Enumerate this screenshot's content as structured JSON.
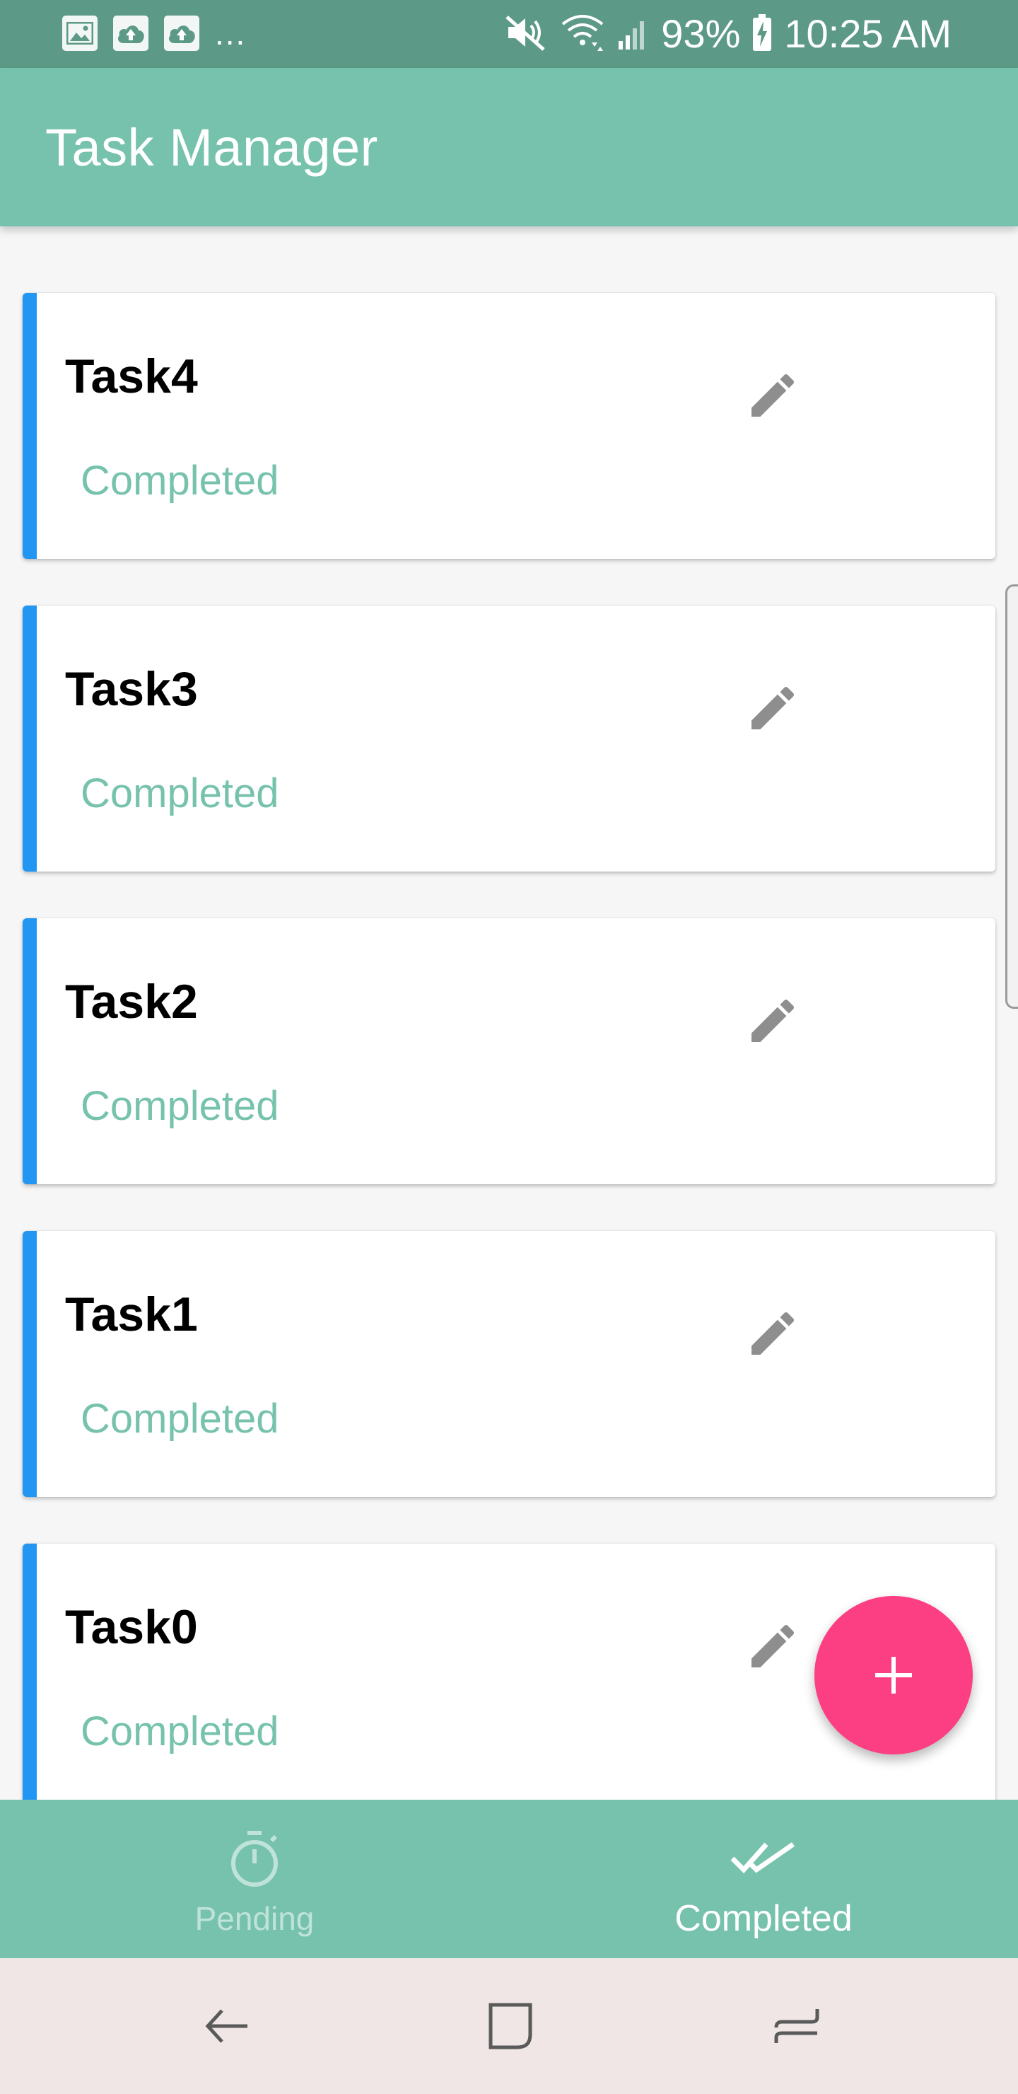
{
  "status_bar": {
    "overflow_indicator": "...",
    "battery_percent": "93%",
    "time": "10:25 AM",
    "left_icons": [
      "image-icon",
      "cloud-upload-icon",
      "cloud-upload-icon"
    ],
    "right_icons": [
      "mute-icon",
      "wifi-icon",
      "signal-icon",
      "battery-charging-icon"
    ]
  },
  "app_bar": {
    "title": "Task Manager"
  },
  "tasks": [
    {
      "title": "Task4",
      "status": "Completed",
      "action_icon": "pencil-icon"
    },
    {
      "title": "Task3",
      "status": "Completed",
      "action_icon": "pencil-icon"
    },
    {
      "title": "Task2",
      "status": "Completed",
      "action_icon": "pencil-icon"
    },
    {
      "title": "Task1",
      "status": "Completed",
      "action_icon": "pencil-icon"
    },
    {
      "title": "Task0",
      "status": "Completed",
      "action_icon": "pencil-icon"
    }
  ],
  "fab": {
    "icon": "plus-icon"
  },
  "bottom_nav": {
    "tabs": [
      {
        "label": "Pending",
        "icon": "stopwatch-icon",
        "selected": false
      },
      {
        "label": "Completed",
        "icon": "double-check-icon",
        "selected": true
      }
    ]
  },
  "system_nav": {
    "buttons": [
      "back-icon",
      "home-icon",
      "recents-icon"
    ]
  },
  "colors": {
    "status_bar": "#5c9a87",
    "primary": "#76c2ad",
    "accent_fab": "#fb3f82",
    "card_accent": "#2196f3",
    "status_text": "#76c2ad",
    "system_nav": "#efe6e5"
  }
}
